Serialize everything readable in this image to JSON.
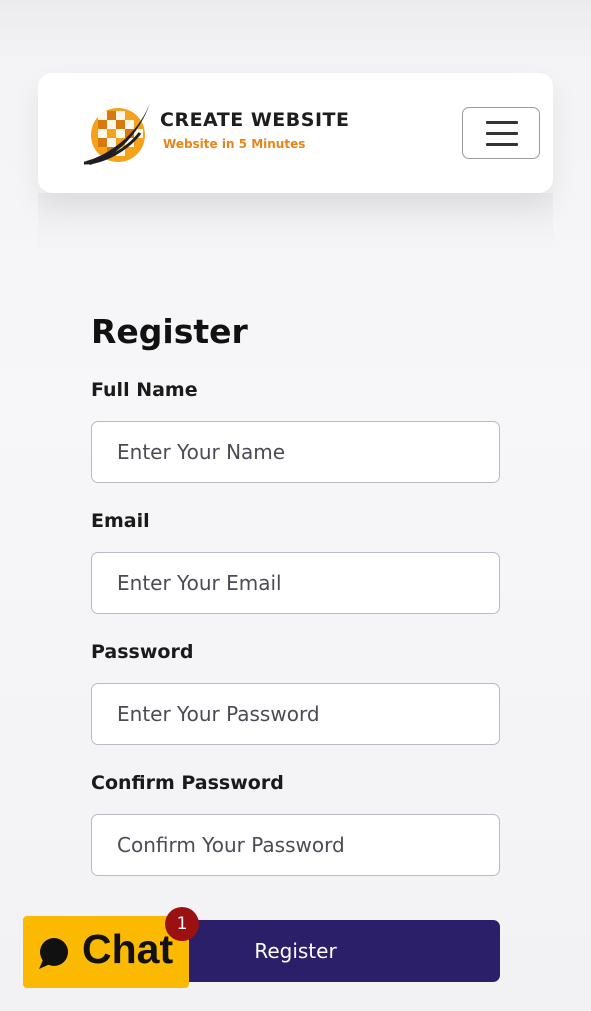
{
  "header": {
    "logo_title": "CREATE WEBSITE",
    "logo_tagline": "Website in 5 Minutes",
    "menu_icon": "hamburger-menu-icon"
  },
  "form": {
    "title": "Register",
    "fields": [
      {
        "label": "Full Name",
        "placeholder": "Enter Your Name",
        "type": "text"
      },
      {
        "label": "Email",
        "placeholder": "Enter Your Email",
        "type": "email"
      },
      {
        "label": "Password",
        "placeholder": "Enter Your Password",
        "type": "password"
      },
      {
        "label": "Confirm Password",
        "placeholder": "Confirm Your Password",
        "type": "password"
      }
    ],
    "submit_label": "Register"
  },
  "chat": {
    "label": "Chat",
    "badge_count": "1",
    "icon": "chat-bubble-icon"
  },
  "colors": {
    "primary_button": "#2a1f68",
    "chat_widget": "#fbb902",
    "badge": "#9b1111",
    "logo_accent": "#e8851a"
  }
}
